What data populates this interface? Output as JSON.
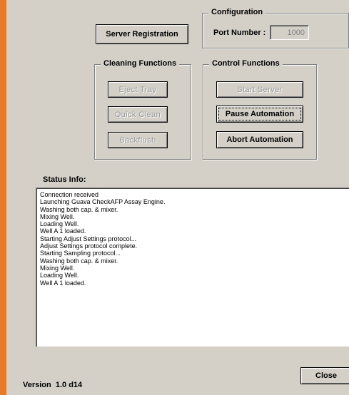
{
  "configuration": {
    "title": "Configuration",
    "port_label": "Port Number :",
    "port_value": "1000"
  },
  "buttons": {
    "server_registration": "Server Registration",
    "close": "Close"
  },
  "cleaning": {
    "title": "Cleaning Functions",
    "eject_tray": "Eject Tray",
    "quick_clean": "Quick Clean",
    "backflush": "Backflush"
  },
  "control": {
    "title": "Control Functions",
    "start_server": "Start Server",
    "pause_automation": "Pause Automation",
    "abort_automation": "Abort Automation"
  },
  "status": {
    "label": "Status Info:",
    "lines": [
      "Connection received",
      "Launching Guava CheckAFP Assay Engine.",
      "Washing both cap. & mixer.",
      "Mixing Well.",
      "Loading Well.",
      "Well A 1 loaded.",
      "Starting Adjust Settings protocol...",
      "Adjust Settings protocol complete.",
      "Starting Sampling protocol...",
      "Washing both cap. & mixer.",
      "Mixing Well.",
      "Loading Well.",
      "Well A 1 loaded."
    ]
  },
  "version": "Version  1.0 d14"
}
